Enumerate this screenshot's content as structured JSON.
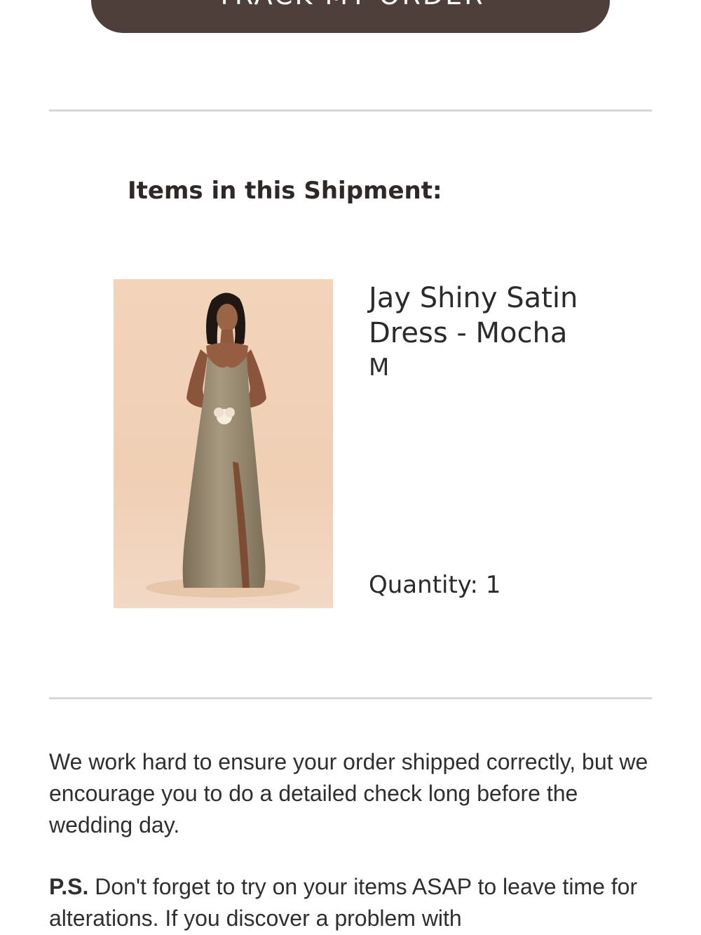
{
  "header": {
    "track_button_label": "TRACK MY ORDER"
  },
  "shipment": {
    "title": "Items in this Shipment:",
    "items": [
      {
        "name": "Jay Shiny Satin Dress - Mocha",
        "size": "M",
        "quantity_label": "Quantity: 1"
      }
    ]
  },
  "note": {
    "message": "We work hard to ensure your order shipped correctly, but we encourage you to do a detailed check long before the wedding day.",
    "ps_label": "P.S.",
    "ps_text": "Don't forget to try on your items ASAP to leave time for alterations. If you discover a problem with"
  },
  "colors": {
    "button_bg": "#4e3f3a",
    "divider": "#d6d6d6",
    "image_bg": "#f2d4bb",
    "dress": "#8e8169"
  }
}
